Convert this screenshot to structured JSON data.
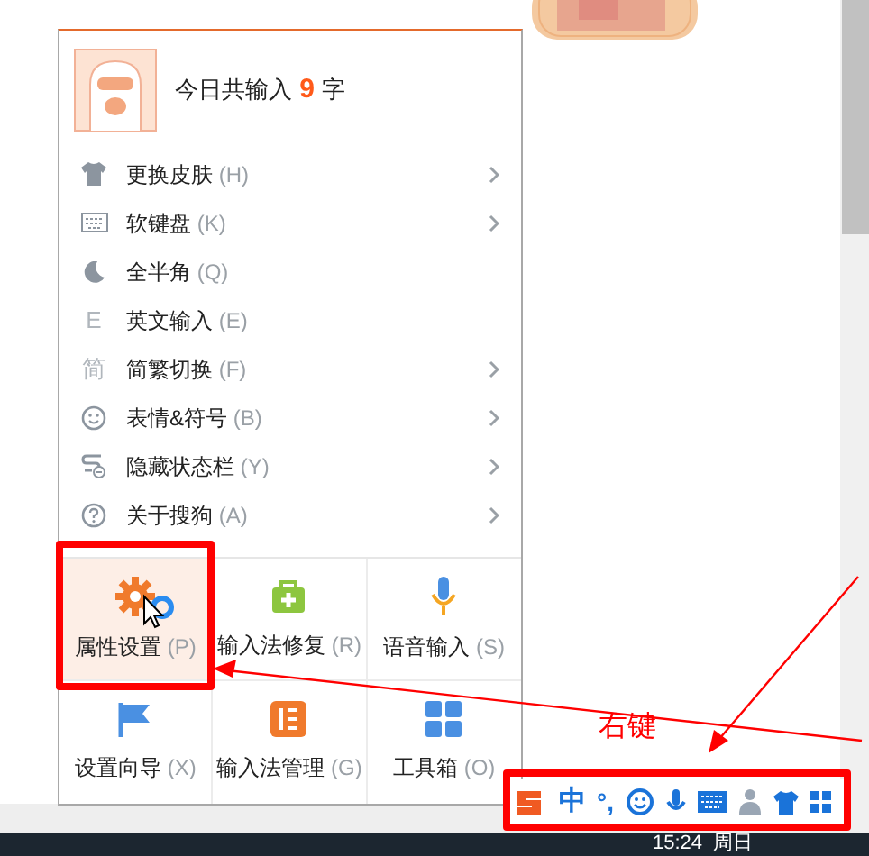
{
  "header": {
    "prefix": "今日共输入",
    "count": "9",
    "suffix": "字"
  },
  "menu_items": [
    {
      "kind": "shirt",
      "label": "更换皮肤",
      "shortcut": "(H)",
      "has_submenu": true
    },
    {
      "kind": "keyboard",
      "label": "软键盘",
      "shortcut": "(K)",
      "has_submenu": true
    },
    {
      "kind": "moon",
      "label": "全半角",
      "shortcut": "(Q)",
      "has_submenu": false
    },
    {
      "kind": "letter",
      "glyph": "E",
      "label": "英文输入",
      "shortcut": "(E)",
      "has_submenu": false
    },
    {
      "kind": "letter",
      "glyph": "简",
      "label": "简繁切换",
      "shortcut": "(F)",
      "has_submenu": true
    },
    {
      "kind": "smiley",
      "label": "表情&符号",
      "shortcut": "(B)",
      "has_submenu": true
    },
    {
      "kind": "hide",
      "label": "隐藏状态栏",
      "shortcut": "(Y)",
      "has_submenu": true
    },
    {
      "kind": "help",
      "label": "关于搜狗",
      "shortcut": "(A)",
      "has_submenu": true
    }
  ],
  "grid": [
    {
      "kind": "gear",
      "label": "属性设置",
      "shortcut": "(P)",
      "selected": true
    },
    {
      "kind": "repair",
      "label": "输入法修复",
      "shortcut": "(R)",
      "selected": false
    },
    {
      "kind": "mic",
      "label": "语音输入",
      "shortcut": "(S)",
      "selected": false
    },
    {
      "kind": "flag",
      "label": "设置向导",
      "shortcut": "(X)",
      "selected": false
    },
    {
      "kind": "manage",
      "label": "输入法管理",
      "shortcut": "(G)",
      "selected": false
    },
    {
      "kind": "tiles",
      "label": "工具箱",
      "shortcut": "(O)",
      "selected": false
    }
  ],
  "annotation": "右键",
  "status_bar": {
    "mode": "中",
    "punct": "°,"
  },
  "taskbar": {
    "time": "15:24",
    "day": "周日"
  }
}
